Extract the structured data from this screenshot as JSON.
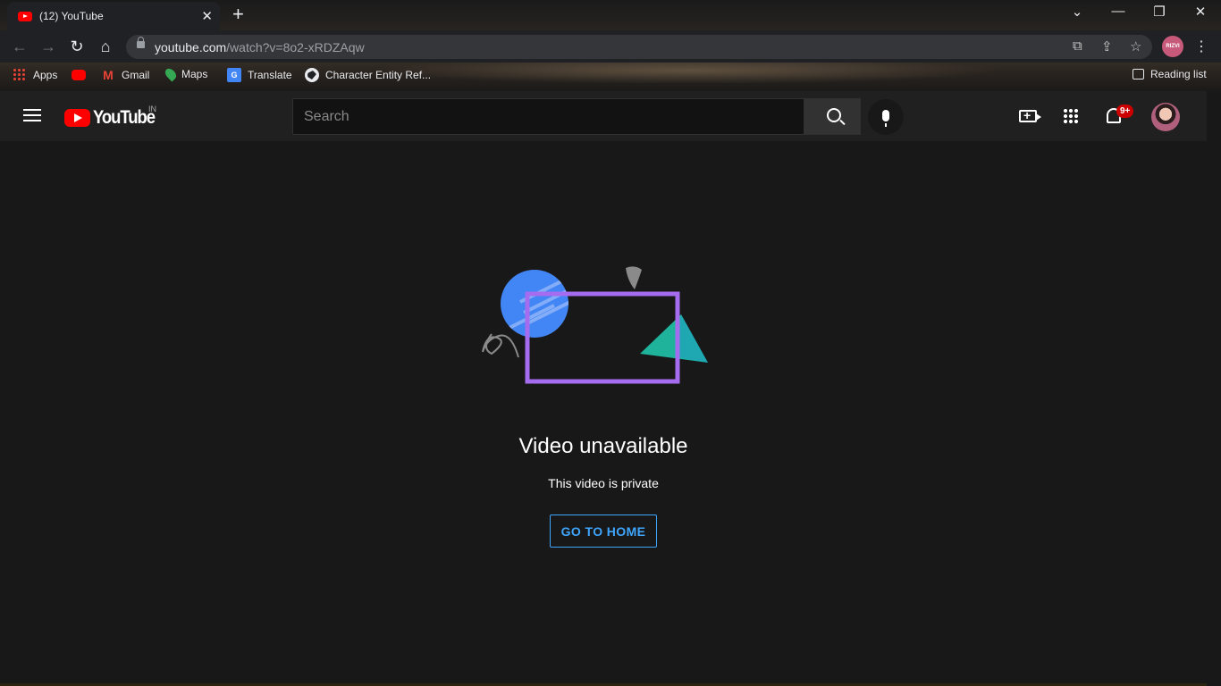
{
  "browser": {
    "tab_title": "(12) YouTube",
    "tab_close": "✕",
    "new_tab": "+",
    "url_host": "youtube.com",
    "url_path": "/watch?v=8o2-xRDZAqw",
    "profile_initials": "RIZVI",
    "window_controls": {
      "menu": "⌄",
      "minimize": "—",
      "restore": "❐",
      "close": "✕"
    },
    "bookmarks": [
      {
        "label": "Apps",
        "icon": "apps-grid-icon"
      },
      {
        "label": "",
        "icon": "youtube-icon"
      },
      {
        "label": "Gmail",
        "icon": "gmail-icon"
      },
      {
        "label": "Maps",
        "icon": "maps-icon"
      },
      {
        "label": "Translate",
        "icon": "translate-icon"
      },
      {
        "label": "Character Entity Ref...",
        "icon": "globe-icon"
      }
    ],
    "reading_list": "Reading list"
  },
  "youtube": {
    "logo_text": "YouTube",
    "country_code": "IN",
    "search_placeholder": "Search",
    "notification_badge": "9+"
  },
  "main": {
    "title": "Video unavailable",
    "subtitle": "This video is private",
    "home_button": "GO TO HOME"
  },
  "colors": {
    "accent": "#3ea6ff",
    "brand_red": "#ff0000",
    "illustration_blue": "#4285f4",
    "illustration_purple": "#a56cf0",
    "illustration_teal": "#1fb39b"
  }
}
